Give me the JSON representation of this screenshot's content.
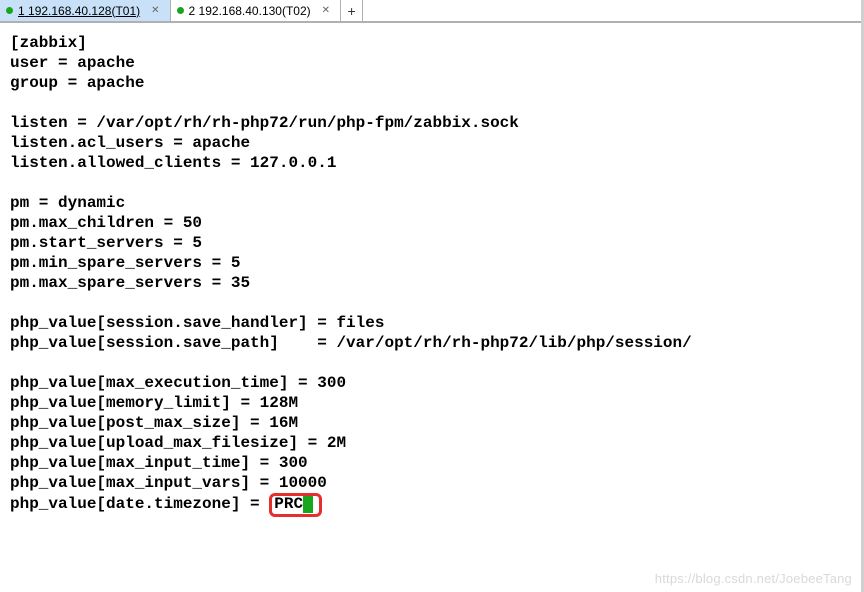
{
  "tabs": {
    "items": [
      {
        "index": "1",
        "label": "192.168.40.128(T01)",
        "dot_color": "#19a51e",
        "active": true
      },
      {
        "index": "2",
        "label": "192.168.40.130(T02)",
        "dot_color": "#19a51e",
        "active": false
      }
    ],
    "add_label": "+"
  },
  "terminal": {
    "lines": [
      "[zabbix]",
      "user = apache",
      "group = apache",
      "",
      "listen = /var/opt/rh/rh-php72/run/php-fpm/zabbix.sock",
      "listen.acl_users = apache",
      "listen.allowed_clients = 127.0.0.1",
      "",
      "pm = dynamic",
      "pm.max_children = 50",
      "pm.start_servers = 5",
      "pm.min_spare_servers = 5",
      "pm.max_spare_servers = 35",
      "",
      "php_value[session.save_handler] = files",
      "php_value[session.save_path]    = /var/opt/rh/rh-php72/lib/php/session/",
      "",
      "php_value[max_execution_time] = 300",
      "php_value[memory_limit] = 128M",
      "php_value[post_max_size] = 16M",
      "php_value[upload_max_filesize] = 2M",
      "php_value[max_input_time] = 300",
      "php_value[max_input_vars] = 10000"
    ],
    "last_line_prefix": "php_value[date.timezone] = ",
    "highlighted_value": "PRC",
    "cursor_color": "#19a51e"
  },
  "watermark": "https://blog.csdn.net/JoebeeTang"
}
